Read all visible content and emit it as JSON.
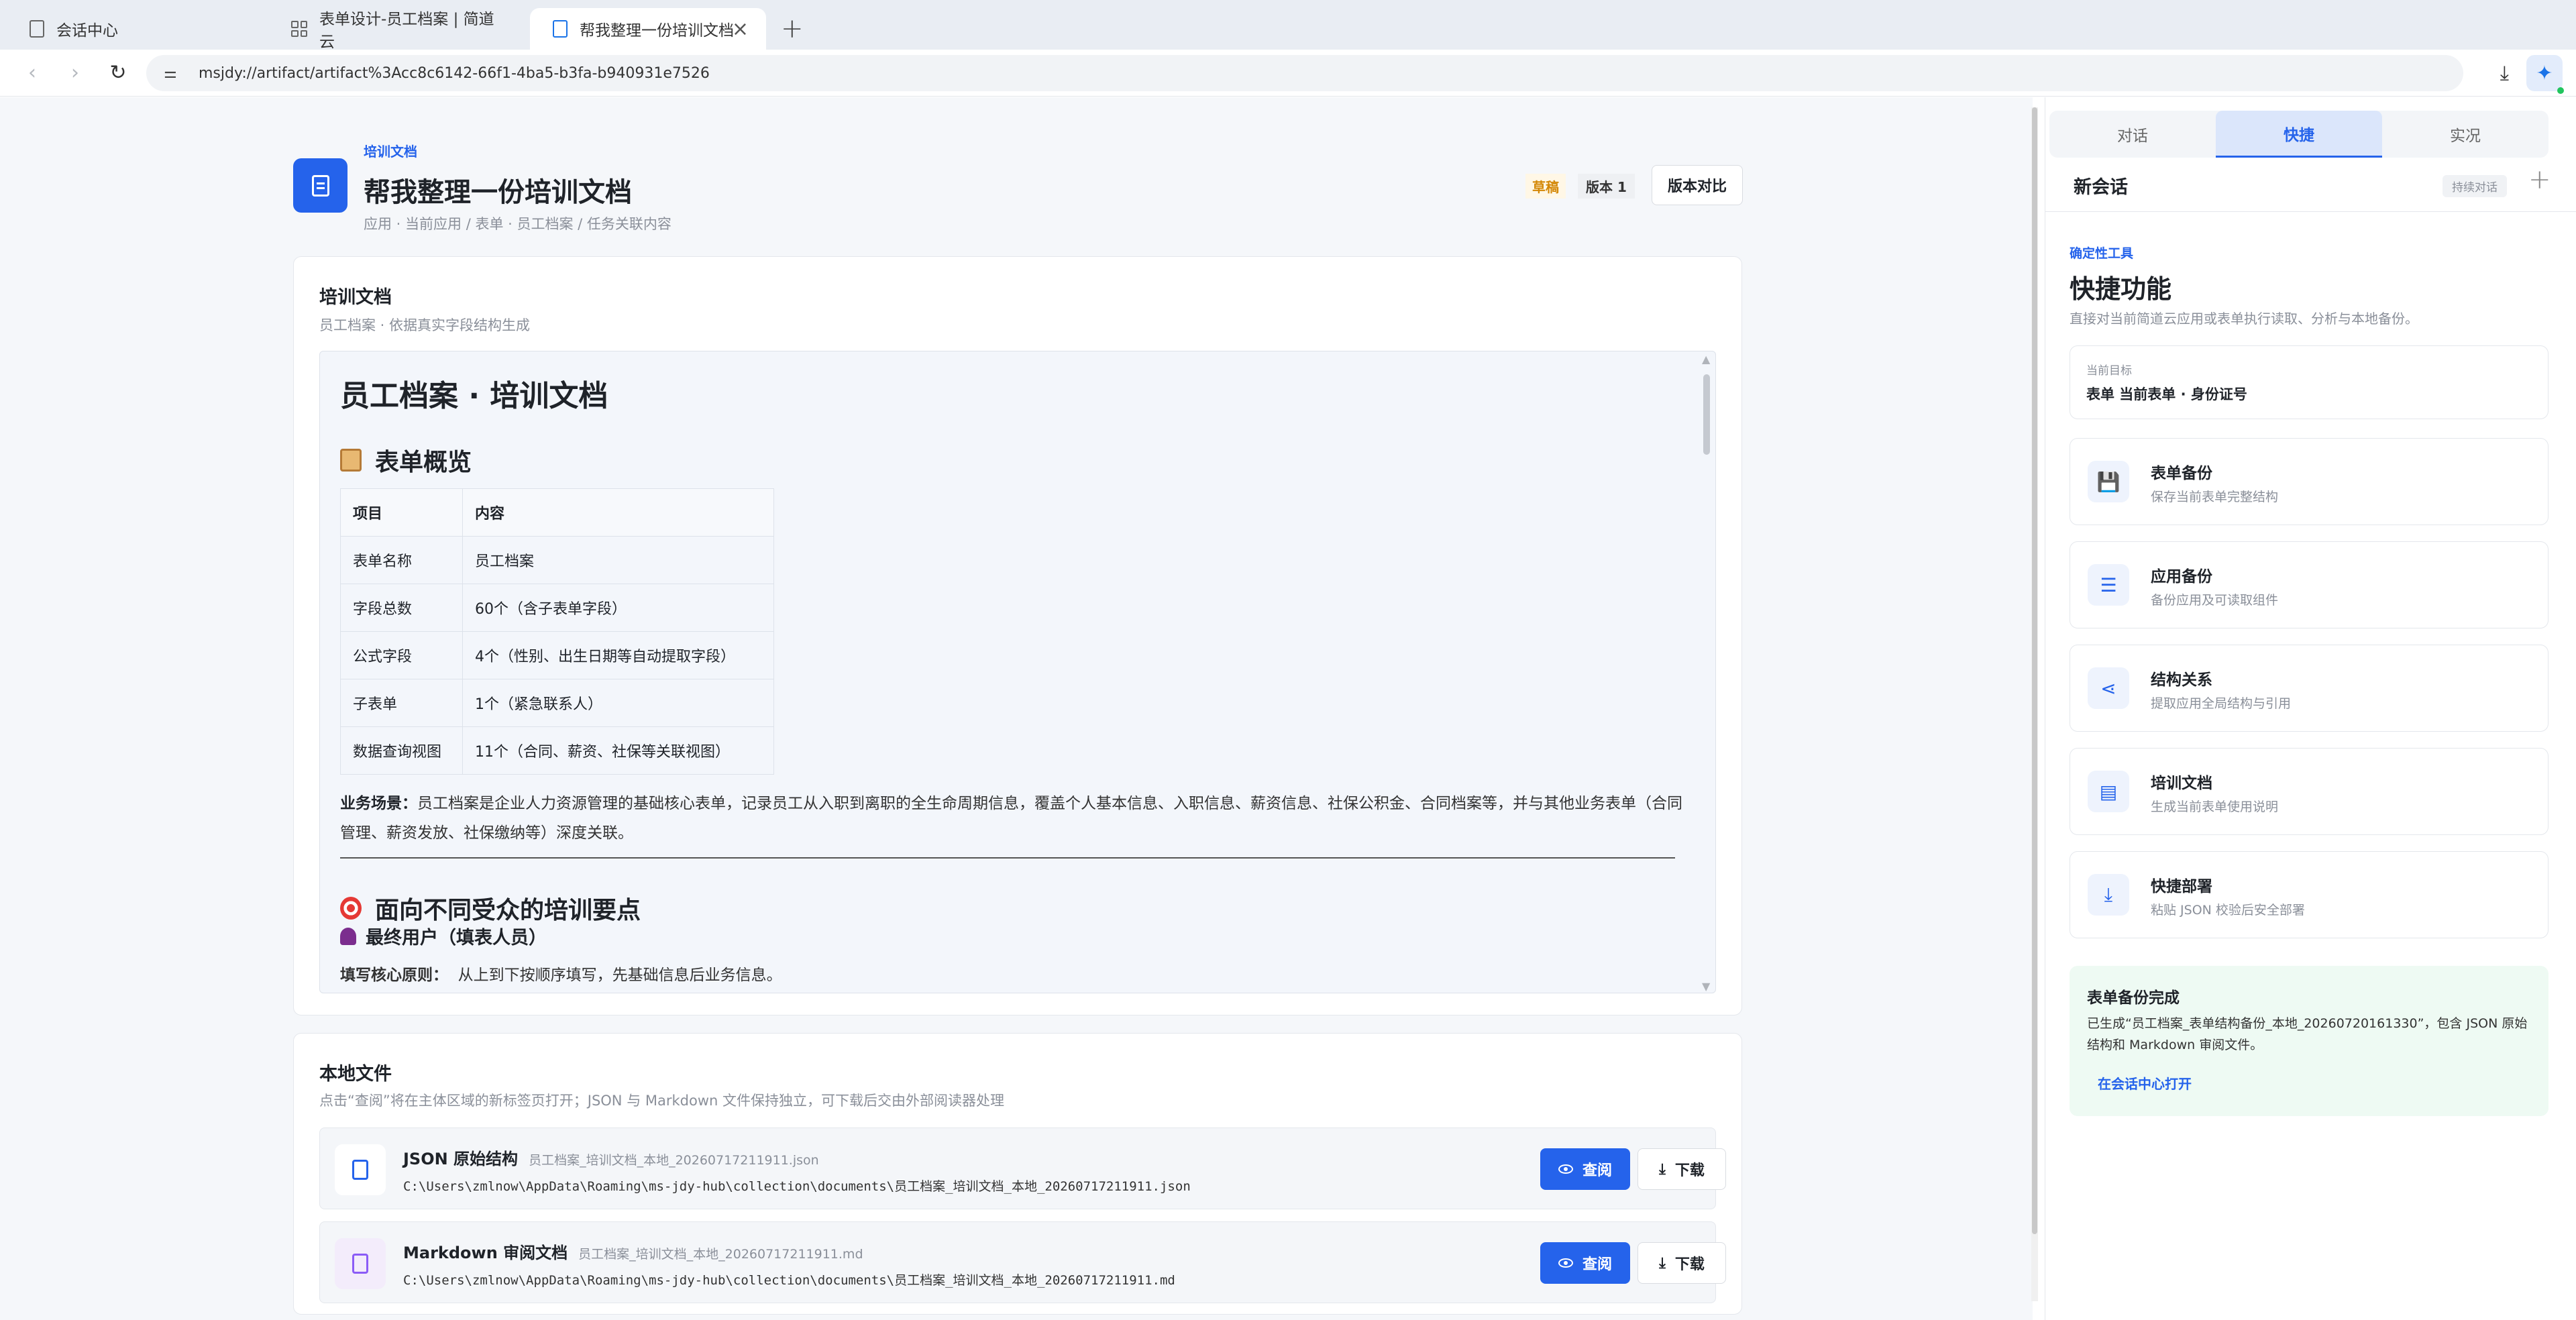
{
  "browser": {
    "tabs": [
      {
        "label": "会话中心"
      },
      {
        "label": "表单设计-员工档案 | 简道云"
      },
      {
        "label": "帮我整理一份培训文档"
      }
    ],
    "url": "msjdy://artifact/artifact%3Acc8c6142-66f1-4ba5-b3fa-b940931e7526"
  },
  "header": {
    "tag": "培训文档",
    "title": "帮我整理一份培训文档",
    "breadcrumb": "应用 · 当前应用 / 表单 · 员工档案 / 任务关联内容",
    "draft_badge": "草稿",
    "version_badge": "版本 1",
    "compare_label": "版本对比"
  },
  "doc_card": {
    "title": "培训文档",
    "subtitle": "员工档案 · 依据真实字段结构生成",
    "doc_title": "员工档案 · 培训文档",
    "section1": "表单概览",
    "table": {
      "headers": [
        "项目",
        "内容"
      ],
      "rows": [
        [
          "表单名称",
          "员工档案"
        ],
        [
          "字段总数",
          "60个（含子表单字段）"
        ],
        [
          "公式字段",
          "4个（性别、出生日期等自动提取字段）"
        ],
        [
          "子表单",
          "1个（紧急联系人）"
        ],
        [
          "数据查询视图",
          "11个（合同、薪资、社保等关联视图）"
        ]
      ]
    },
    "scenario_label": "业务场景：",
    "scenario_text": "员工档案是企业人力资源管理的基础核心表单，记录员工从入职到离职的全生命周期信息，覆盖个人基本信息、入职信息、薪资信息、社保公积金、合同档案等，并与其他业务表单（合同管理、薪资发放、社保缴纳等）深度关联。",
    "section2": "面向不同受众的培训要点",
    "subsection": "最终用户（填表人员）",
    "principle_label": "填写核心原则：",
    "principle_text": "从上到下按顺序填写，先基础信息后业务信息。"
  },
  "files_card": {
    "title": "本地文件",
    "subtitle": "点击“查阅”将在主体区域的新标签页打开；JSON 与 Markdown 文件保持独立，可下载后交由外部阅读器处理",
    "view_label": "查阅",
    "download_label": "下载",
    "files": [
      {
        "name": "JSON 原始结构",
        "filename": "员工档案_培训文档_本地_20260717211911.json",
        "path": "C:\\Users\\zmlnow\\AppData\\Roaming\\ms-jdy-hub\\collection\\documents\\员工档案_培训文档_本地_20260717211911.json"
      },
      {
        "name": "Markdown 审阅文档",
        "filename": "员工档案_培训文档_本地_20260717211911.md",
        "path": "C:\\Users\\zmlnow\\AppData\\Roaming\\ms-jdy-hub\\collection\\documents\\员工档案_培训文档_本地_20260717211911.md"
      }
    ]
  },
  "panel": {
    "tabs": [
      "对话",
      "快捷",
      "实况"
    ],
    "new_session": "新会话",
    "continuous": "持续对话",
    "tool_tag": "确定性工具",
    "title": "快捷功能",
    "desc": "直接对当前简道云应用或表单执行读取、分析与本地备份。",
    "target_label": "当前目标",
    "target_value": "表单 当前表单 · 身份证号",
    "tools": [
      {
        "title": "表单备份",
        "desc": "保存当前表单完整结构",
        "icon": "save-icon"
      },
      {
        "title": "应用备份",
        "desc": "备份应用及可读取组件",
        "icon": "list-icon"
      },
      {
        "title": "结构关系",
        "desc": "提取应用全局结构与引用",
        "icon": "share-icon"
      },
      {
        "title": "培训文档",
        "desc": "生成当前表单使用说明",
        "icon": "document-icon"
      },
      {
        "title": "快捷部署",
        "desc": "粘贴 JSON 校验后安全部署",
        "icon": "download-icon"
      }
    ],
    "done_title": "表单备份完成",
    "done_msg": "已生成“员工档案_表单结构备份_本地_20260720161330”，包含 JSON 原始结构和 Markdown 审阅文件。",
    "done_action": "在会话中心打开"
  }
}
